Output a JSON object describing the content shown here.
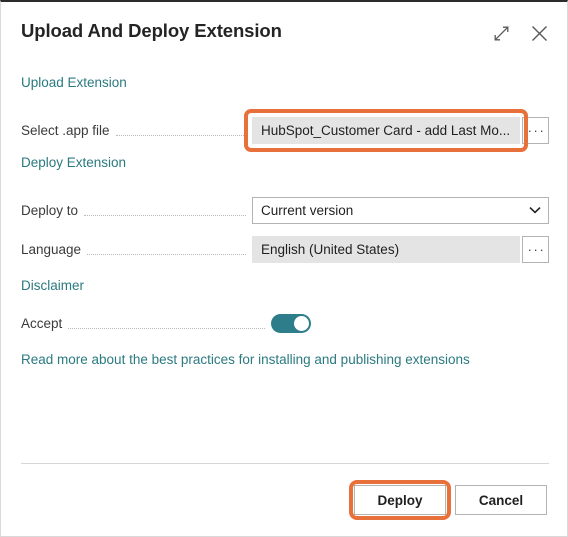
{
  "dialog": {
    "title": "Upload And Deploy Extension",
    "expand_icon": "expand-icon",
    "close_icon": "close-icon"
  },
  "sections": {
    "upload": "Upload Extension",
    "deploy": "Deploy Extension",
    "disclaimer": "Disclaimer"
  },
  "fields": {
    "file": {
      "label": "Select .app file",
      "value": "HubSpot_Customer Card - add Last Mo...",
      "placeholder": "",
      "assist_label": "···",
      "highlighted": "true"
    },
    "deploy_to": {
      "label": "Deploy to",
      "value": "Current version",
      "options": [
        "Current version"
      ],
      "chevron": "chevron-down-icon"
    },
    "language": {
      "label": "Language",
      "value": "English (United States)",
      "assist_label": "···"
    },
    "accept": {
      "label": "Accept",
      "state": "on"
    }
  },
  "links": {
    "read_more": "Read more about the best practices for installing and publishing extensions"
  },
  "footer": {
    "deploy_label": "Deploy",
    "cancel_label": "Cancel"
  },
  "colors": {
    "accent_teal": "#2b7a80",
    "highlight_orange": "#e8703a",
    "toggle_on": "#2e7d8a",
    "field_readonly_bg": "#e4e4e4"
  }
}
